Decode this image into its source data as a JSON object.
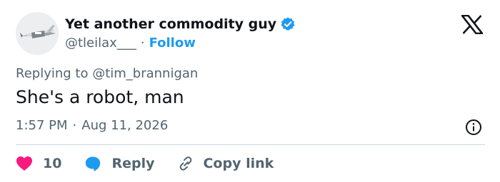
{
  "author": {
    "display_name": "Yet another commodity guy",
    "handle": "@tleilax___",
    "follow_label": "Follow",
    "verified_color": "#1d9bf0"
  },
  "reply_context": {
    "prefix": "Replying to ",
    "mention": "@tim_brannigan"
  },
  "tweet": {
    "text": "She's a robot, man",
    "time": "1:57 PM",
    "date": "Aug 11, 2026"
  },
  "actions": {
    "like_count": "10",
    "reply_label": "Reply",
    "copy_label": "Copy link"
  },
  "colors": {
    "like": "#f91880",
    "reply": "#1d9bf0",
    "link": "#1d9bf0",
    "muted": "#536471"
  },
  "icons": [
    "verified-badge-icon",
    "x-logo-icon",
    "info-icon",
    "heart-icon",
    "reply-bubble-icon",
    "link-icon"
  ]
}
